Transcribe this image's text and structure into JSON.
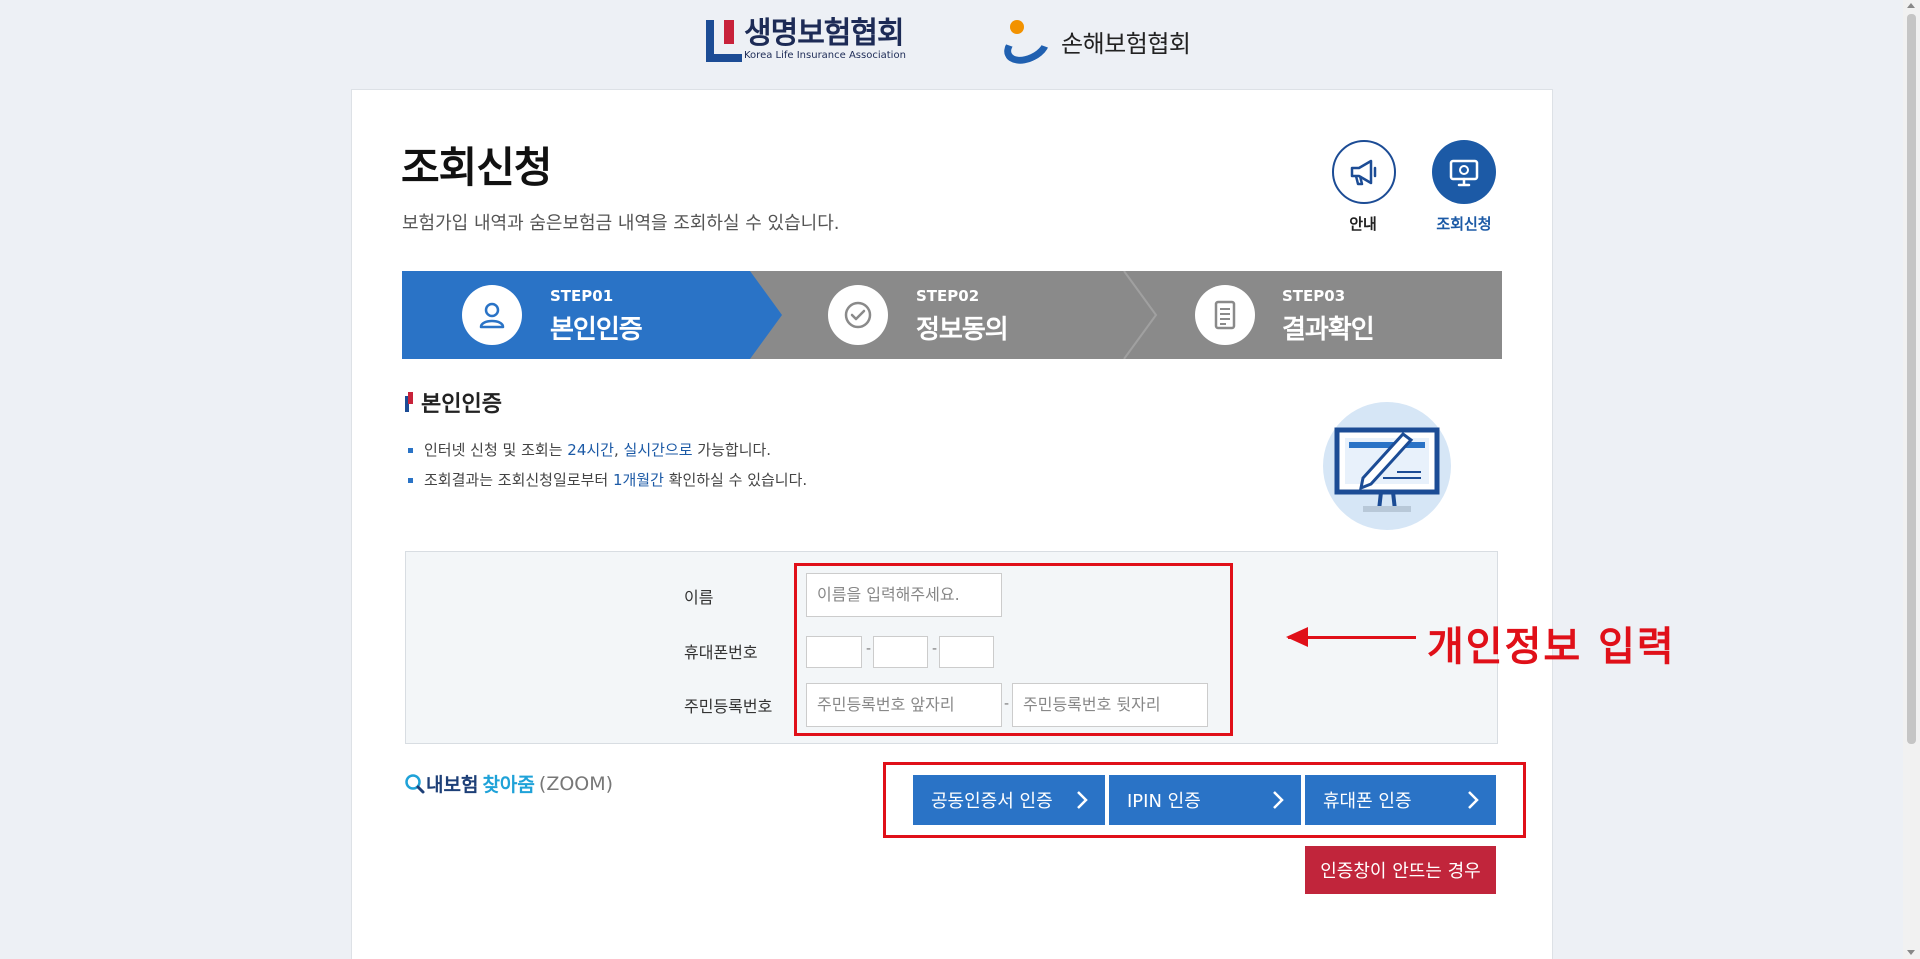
{
  "header": {
    "logo1_ko": "생명보험협회",
    "logo1_en": "Korea Life Insurance Association",
    "logo2_text": "손해보험협회"
  },
  "page": {
    "title": "조회신청",
    "subtitle": "보험가입 내역과 숨은보험금 내역을 조회하실 수 있습니다."
  },
  "quick_links": [
    {
      "label": "안내",
      "icon": "megaphone-icon"
    },
    {
      "label": "조회신청",
      "icon": "monitor-search-icon"
    }
  ],
  "steps": [
    {
      "no": "STEP01",
      "name": "본인인증",
      "active": true,
      "icon": "person-icon"
    },
    {
      "no": "STEP02",
      "name": "정보동의",
      "active": false,
      "icon": "check-circle-icon"
    },
    {
      "no": "STEP03",
      "name": "결과확인",
      "active": false,
      "icon": "document-icon"
    }
  ],
  "section": {
    "title": "본인인증",
    "bullet1": {
      "a": "인터넷 신청 및 조회는 ",
      "b": "24시간",
      "c": ", ",
      "d": "실시간으로",
      "e": " 가능합니다."
    },
    "bullet2": {
      "a": "조회결과는 조회신청일로부터 ",
      "b": "1개월간",
      "c": " 확인하실 수 있습니다."
    }
  },
  "form": {
    "name_label": "이름",
    "name_placeholder": "이름을 입력해주세요.",
    "phone_label": "휴대폰번호",
    "phone_sep": "-",
    "rrn_label": "주민등록번호",
    "rrn_front_placeholder": "주민등록번호 앞자리",
    "rrn_back_placeholder": "주민등록번호 뒷자리",
    "rrn_sep": "-"
  },
  "annotation": "개인정보 입력",
  "zoom": {
    "part1": "내보험",
    "part2": "찾아줌",
    "part3": "(ZOOM)"
  },
  "auth_buttons": [
    "공동인증서 인증",
    "IPIN 인증",
    "휴대폰 인증"
  ],
  "trouble_button": "인증창이 안뜨는 경우",
  "colors": {
    "primary": "#2a73c6",
    "navy": "#1c4c95",
    "red_accent": "#e01019",
    "trouble": "#c1253b",
    "step_inactive": "#8a8a8a"
  }
}
